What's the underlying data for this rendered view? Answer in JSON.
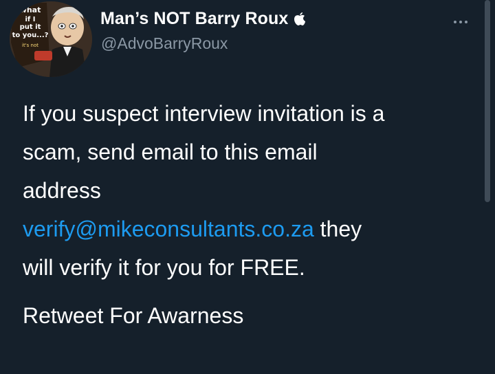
{
  "avatar": {
    "lines": [
      "what",
      "if I",
      "put it",
      "to you...?",
      "it's not"
    ]
  },
  "author": {
    "display_name": "Man’s NOT Barry Roux",
    "badge_icon": "apple-icon",
    "handle": "@AdvoBarryRoux"
  },
  "menu": {
    "icon": "more-horizontal-icon"
  },
  "tweet": {
    "line1": "If you suspect interview invitation is a",
    "line2": "scam, send email to this email",
    "line3": "address",
    "email": "verify@mikeconsultants.co.za",
    "after_email": "they",
    "line5": "will verify it for you for FREE.",
    "cta": "Retweet For Awarness"
  },
  "colors": {
    "background": "#15202b",
    "text": "#ffffff",
    "muted": "#8b98a5",
    "link": "#1d9bf0"
  }
}
